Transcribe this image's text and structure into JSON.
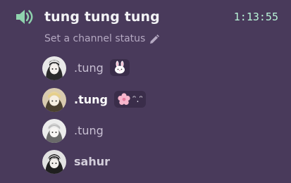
{
  "channel": {
    "name": "tung tung tung",
    "elapsed": "1:13:55",
    "status_prompt": "Set a channel status"
  },
  "users": [
    {
      "name": ".tung",
      "status_icon": "bunny-emoji",
      "status_text": ""
    },
    {
      "name": ".tung",
      "status_icon": "cherry-blossom-emoji",
      "status_text": "ᵔ.ᵔ"
    },
    {
      "name": ".tung",
      "status_icon": "",
      "status_text": ""
    },
    {
      "name": "sahur",
      "status_icon": "",
      "status_text": ""
    }
  ],
  "colors": {
    "background": "#493a5b",
    "timer": "#b9f5d8",
    "speaker": "#6fd49c"
  }
}
